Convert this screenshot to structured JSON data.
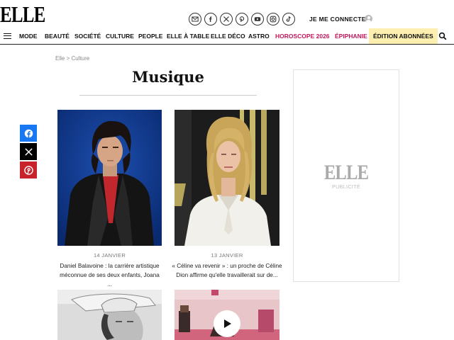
{
  "header": {
    "logo": "ELLE",
    "login_label": "JE ME CONNECTE",
    "socials": [
      {
        "icon": "mail-icon",
        "glyph": "✉"
      },
      {
        "icon": "facebook-icon",
        "glyph": "f"
      },
      {
        "icon": "x-icon",
        "glyph": "X"
      },
      {
        "icon": "pinterest-icon",
        "glyph": "P"
      },
      {
        "icon": "youtube-icon",
        "glyph": "▶"
      },
      {
        "icon": "instagram-icon",
        "glyph": "◎"
      },
      {
        "icon": "tiktok-icon",
        "glyph": "♪"
      }
    ]
  },
  "nav": {
    "items": [
      "MODE",
      "BEAUTÉ",
      "SOCIÉTÉ",
      "CULTURE",
      "PEOPLE",
      "ELLE À TABLE",
      "ELLE DÉCO",
      "ASTRO"
    ],
    "highlight_items": [
      "HOROSCOPE 2026",
      "ÉPIPHANIE"
    ],
    "subscriber_item": "ÉDITION ABONNÉES",
    "accent_color": "#c2185b",
    "subscriber_bg": "#fcefb0"
  },
  "breadcrumb": "Elle > Culture",
  "page_title": "Musique",
  "articles": [
    {
      "date": "14 JANVIER",
      "line1": "Daniel Balavoine : la carrière artistique",
      "line2": "méconnue de ses deux enfants, Joana ..."
    },
    {
      "date": "13 JANVIER",
      "line1": "« Céline va revenir » : un proche de Céline",
      "line2": "Dion affirme qu'elle travaillerait sur de..."
    }
  ],
  "share": [
    {
      "icon": "facebook-icon",
      "color": "#1877f2"
    },
    {
      "icon": "x-icon",
      "color": "#000000"
    },
    {
      "icon": "pinterest-icon",
      "color": "#c8232c"
    }
  ],
  "ad": {
    "logo": "ELLE",
    "label": "PUBLICITÉ"
  }
}
